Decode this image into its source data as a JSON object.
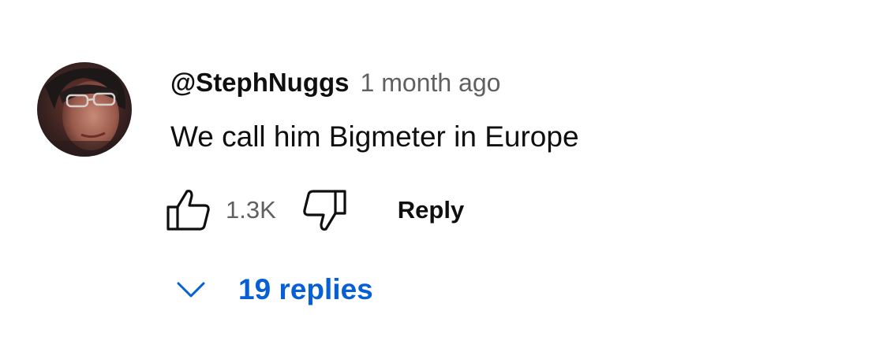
{
  "comment": {
    "author": "@StephNuggs",
    "timestamp": "1 month ago",
    "text": "We call him Bigmeter in Europe",
    "avatar": "user-avatar-photo",
    "likes": "1.3K",
    "reply_label": "Reply",
    "replies_label": "19 replies"
  },
  "icons": {
    "like": "thumbs-up-icon",
    "dislike": "thumbs-down-icon",
    "expand": "chevron-down-icon"
  },
  "colors": {
    "text": "#0f0f0f",
    "secondary": "#606060",
    "link": "#065fd4",
    "background": "#ffffff"
  }
}
